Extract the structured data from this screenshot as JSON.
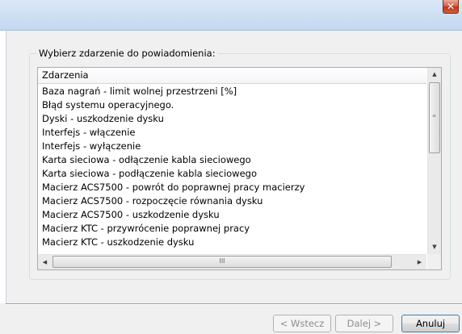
{
  "window": {
    "close_glyph": "✕"
  },
  "group": {
    "legend": "Wybierz zdarzenie do powiadomienia:"
  },
  "list": {
    "column_header": "Zdarzenia",
    "items": [
      "Baza nagrań - limit wolnej przestrzeni [%]",
      "Błąd systemu operacyjnego.",
      "Dyski - uszkodzenie dysku",
      "Interfejs - włączenie",
      "Interfejs - wyłączenie",
      "Karta sieciowa - odłączenie kabla sieciowego",
      "Karta sieciowa - podłączenie kabla sieciowego",
      "Macierz ACS7500 - powrót do poprawnej pracy macierzy",
      "Macierz ACS7500 - rozpoczęcie równania dysku",
      "Macierz ACS7500 - uszkodzenie dysku",
      "Macierz KTC - przywrócenie poprawnej pracy",
      "Macierz KTC - uszkodzenie dysku"
    ]
  },
  "scrollbars": {
    "up_glyph": "▲",
    "down_glyph": "▼",
    "left_glyph": "◀",
    "right_glyph": "▶",
    "grip_glyph": "≡",
    "hgrip_glyph": "III"
  },
  "buttons": {
    "back": "< Wstecz",
    "next": "Dalej >",
    "cancel": "Anuluj"
  }
}
